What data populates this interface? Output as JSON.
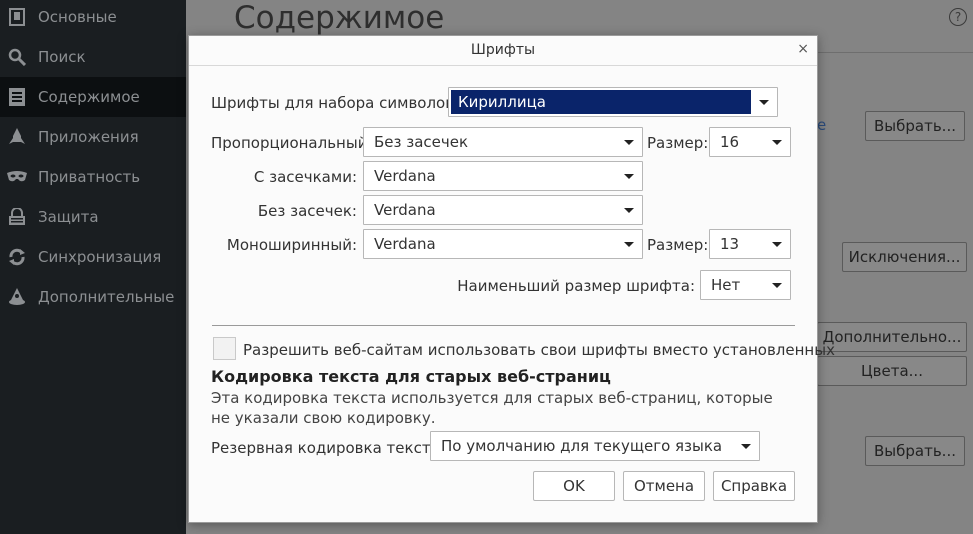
{
  "sidebar": {
    "items": [
      {
        "label": "Основные",
        "icon": "general-icon"
      },
      {
        "label": "Поиск",
        "icon": "search-icon"
      },
      {
        "label": "Содержимое",
        "icon": "content-icon"
      },
      {
        "label": "Приложения",
        "icon": "applications-icon"
      },
      {
        "label": "Приватность",
        "icon": "privacy-mask-icon"
      },
      {
        "label": "Защита",
        "icon": "security-icon"
      },
      {
        "label": "Синхронизация",
        "icon": "sync-icon"
      },
      {
        "label": "Дополнительные",
        "icon": "advanced-icon"
      }
    ]
  },
  "main": {
    "title": "Содержимое",
    "help": "?",
    "link_fragment": "е",
    "buttons": {
      "choose1": "Выбрать...",
      "exceptions": "Исключения...",
      "advanced": "Дополнительно...",
      "colors": "Цвета...",
      "choose2": "Выбрать..."
    }
  },
  "dialog": {
    "title": "Шрифты",
    "close": "×",
    "charset_label": "Шрифты для набора символов:",
    "charset_value": "Кириллица",
    "proportional_label": "Пропорциональный",
    "proportional_value": "Без засечек",
    "size_label": "Размер:",
    "size_prop_value": "16",
    "serif_label": "С засечками:",
    "serif_value": "Verdana",
    "sans_label": "Без засечек:",
    "sans_value": "Verdana",
    "mono_label": "Моноширинный:",
    "mono_value": "Verdana",
    "size_mono_value": "13",
    "min_size_label": "Наименьший размер шрифта:",
    "min_size_value": "Нет",
    "allow_fonts_label": "Разрешить веб-сайтам использовать свои шрифты вместо установленных",
    "allow_fonts_checked": false,
    "encoding_header": "Кодировка текста для старых веб-страниц",
    "encoding_desc": "Эта кодировка текста используется для старых веб-страниц, которые не указали свою кодировку.",
    "fallback_label": "Резервная кодировка текста:",
    "fallback_value": "По умолчанию для текущего языка",
    "ok": "OK",
    "cancel": "Отмена",
    "help": "Справка"
  },
  "colors": {
    "selection": "#0a246a",
    "sidebar_bg": "#1a1e21",
    "sidebar_active": "#0c0f11"
  }
}
